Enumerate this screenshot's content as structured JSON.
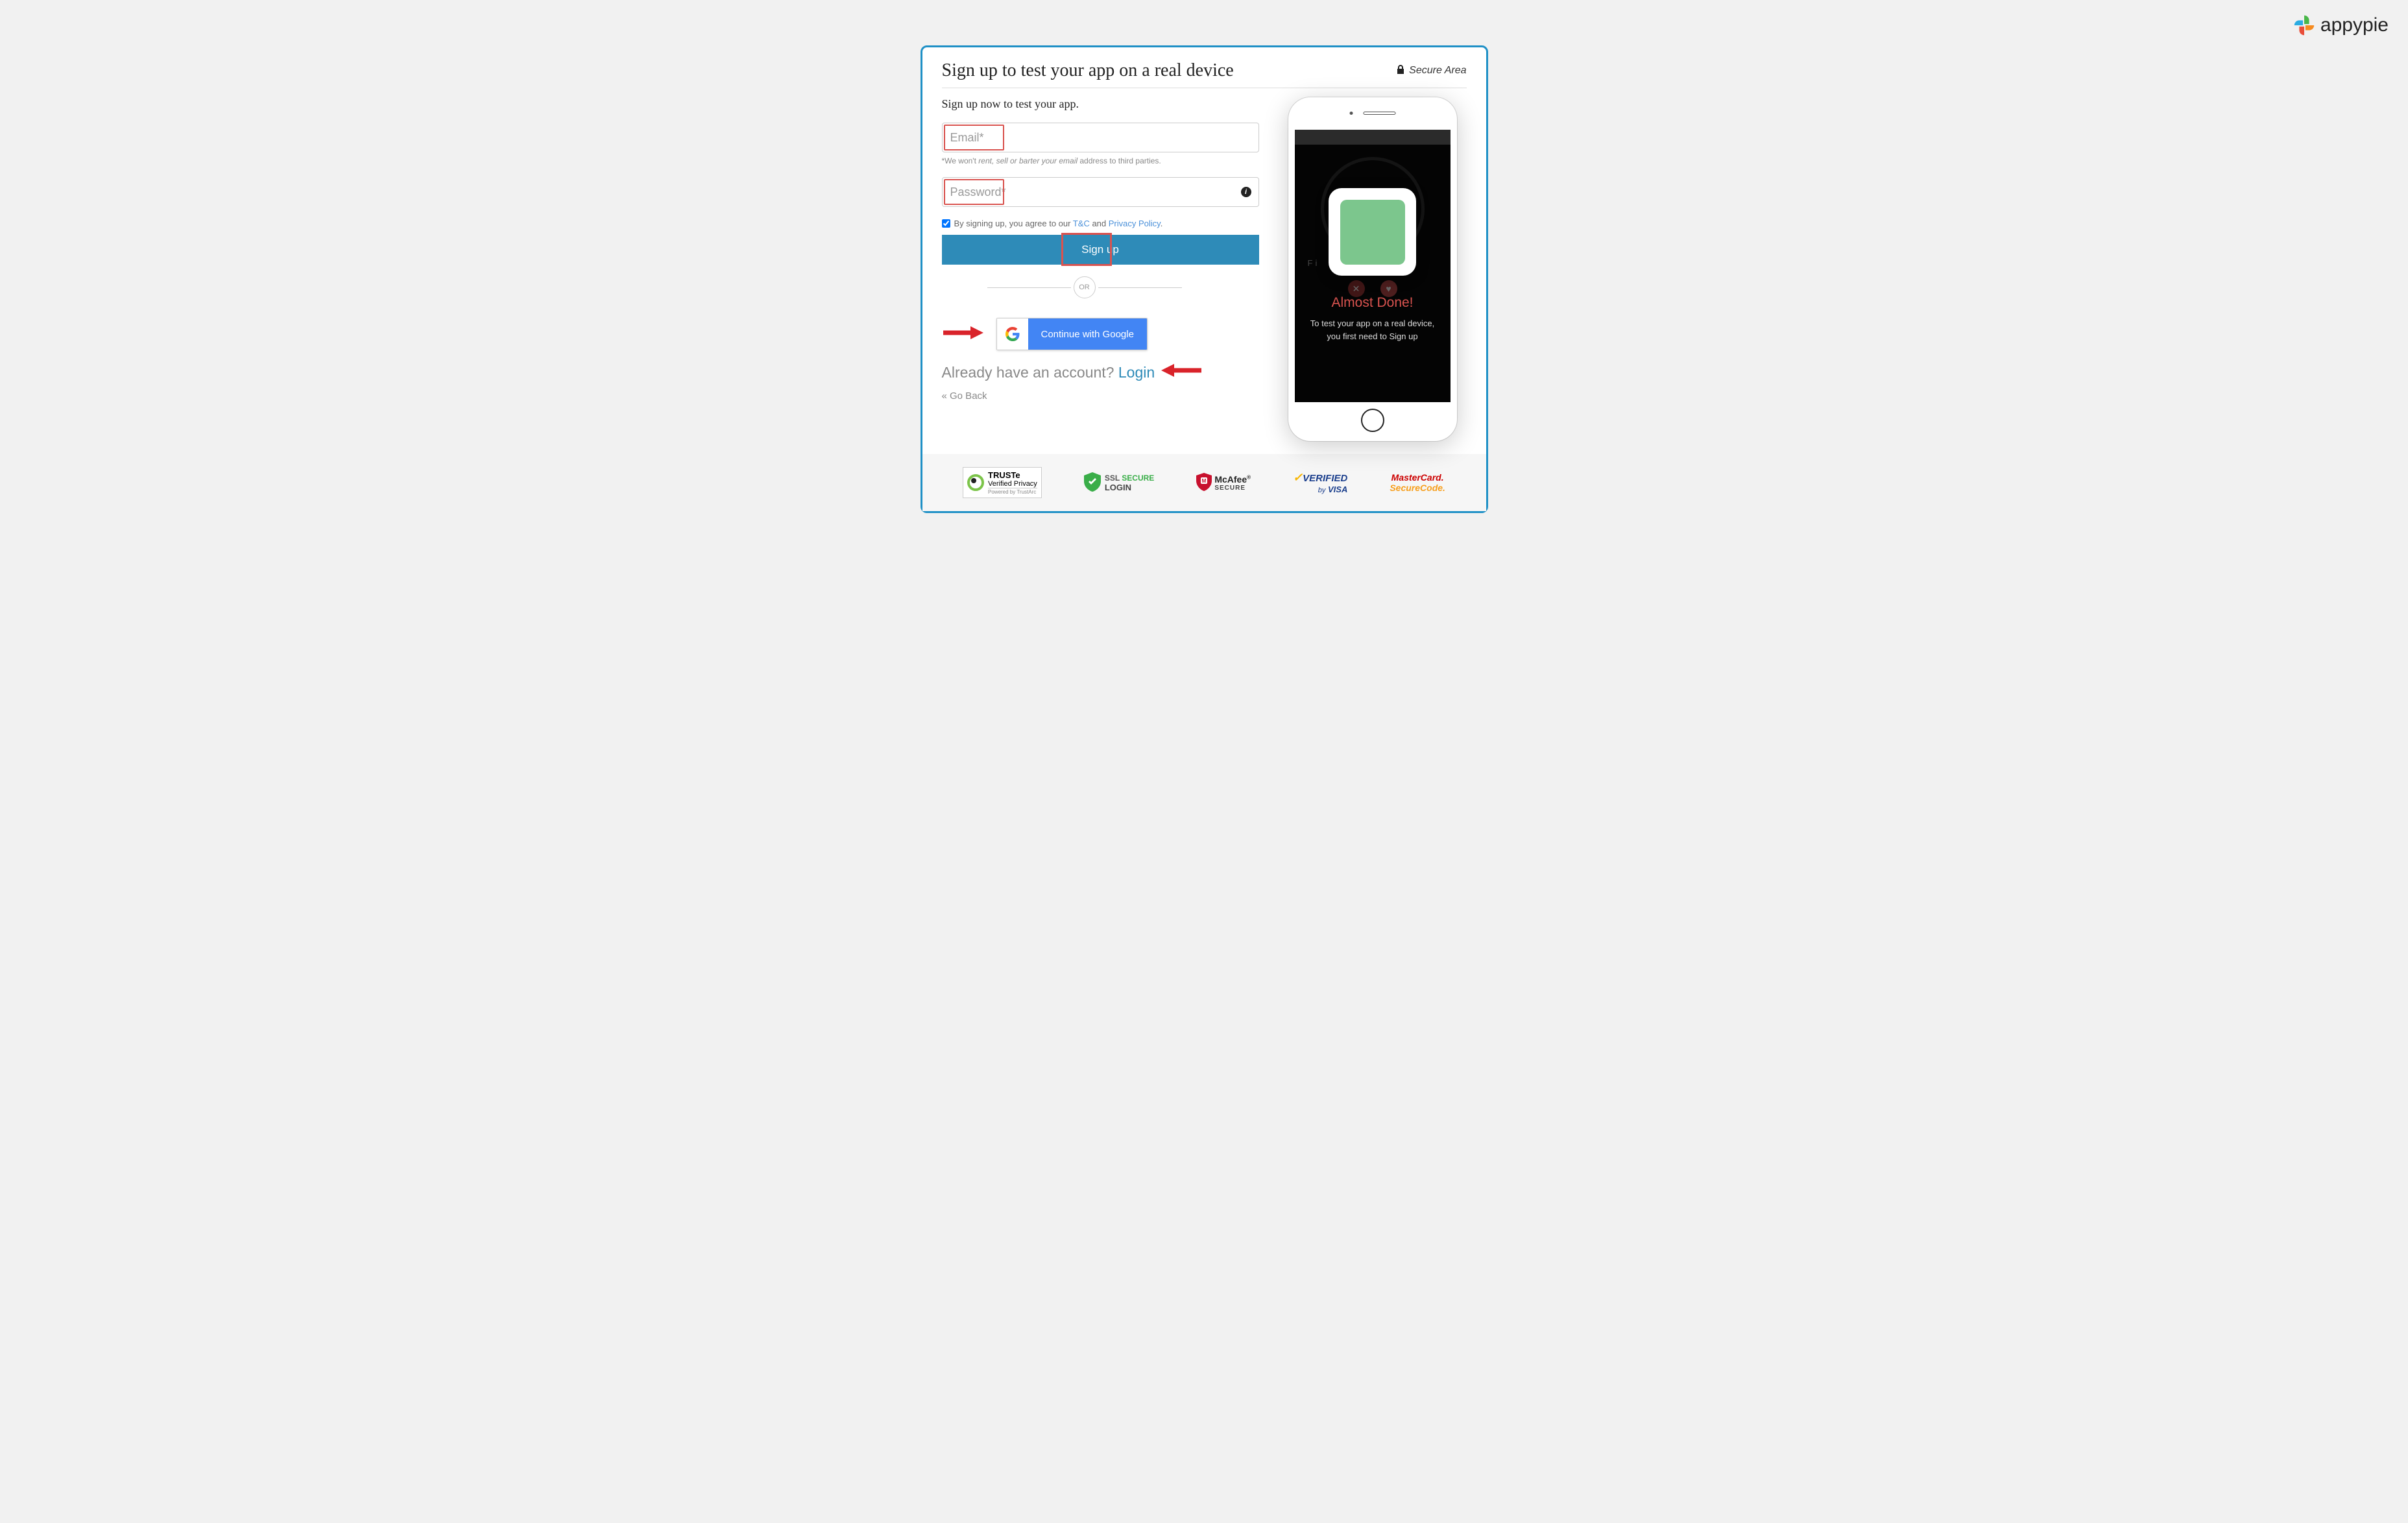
{
  "brand": {
    "name": "appypie"
  },
  "header": {
    "title": "Sign up to test your app on a real device",
    "secure_label": "Secure Area"
  },
  "form": {
    "subtitle": "Sign up now to test your app.",
    "email_placeholder": "Email*",
    "password_placeholder": "Password*",
    "email_helper_prefix": "*We won't",
    "email_helper_mid": " rent, ",
    "email_helper_sell": "sell",
    "email_helper_or": " or ",
    "email_helper_barter": "barter your email",
    "email_helper_suffix": " address to third parties.",
    "consent_prefix": "By signing up, you agree to our ",
    "consent_tc": "T&C",
    "consent_and": " and ",
    "consent_privacy": "Privacy Policy",
    "consent_period": ".",
    "signup_label": "Sign up",
    "divider_label": "OR",
    "google_label": "Continue with Google",
    "login_prompt": "Already have an account? ",
    "login_link": "Login",
    "goback_label": "« Go Back"
  },
  "phone": {
    "almost_title": "Almost Done!",
    "almost_sub_line1": "To test your app on a real device,",
    "almost_sub_line2": "you first need to Sign up",
    "bg_hint": "Fi",
    "bg_dots": "....",
    "x_symbol": "✕",
    "heart_symbol": "♥"
  },
  "badges": {
    "truste_line1": "TRUSTe",
    "truste_line2": "Verified Privacy",
    "truste_line3": "Powered by TrustArc",
    "ssl_line1": "SSL",
    "ssl_secure": "SECURE",
    "ssl_line2": "LOGIN",
    "mcafee_line1": "McAfee",
    "mcafee_line2": "SECURE",
    "visa_verified": "VERIFIED",
    "visa_by": "by",
    "visa_name": "VISA",
    "mc_line1": "MasterCard.",
    "mc_line2": "SecureCode."
  }
}
